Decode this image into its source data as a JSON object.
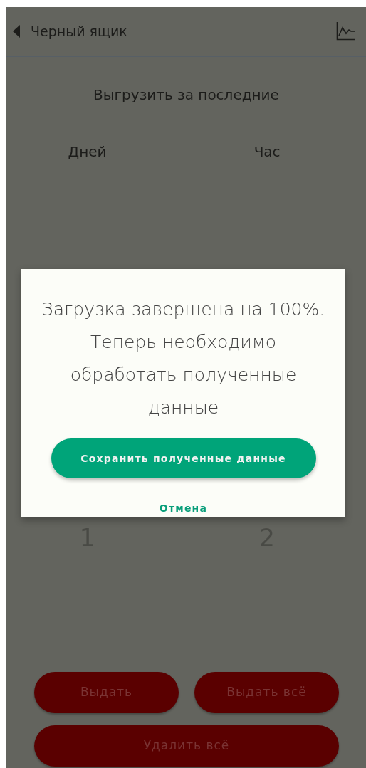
{
  "header": {
    "title": "Черный ящик"
  },
  "export": {
    "title": "Выгрузить за последние",
    "columns": [
      {
        "label": "Дней",
        "value": "1"
      },
      {
        "label": "Час",
        "value": "2"
      }
    ]
  },
  "dialog": {
    "message": "Загрузка завершена на 100%. Теперь необходимо обработать полученные данные",
    "confirm": "Сохранить полученные данные",
    "cancel": "Отмена"
  },
  "actions": [
    [
      "Выдать",
      "Выдать всё"
    ],
    [
      "Удалить всё"
    ]
  ]
}
